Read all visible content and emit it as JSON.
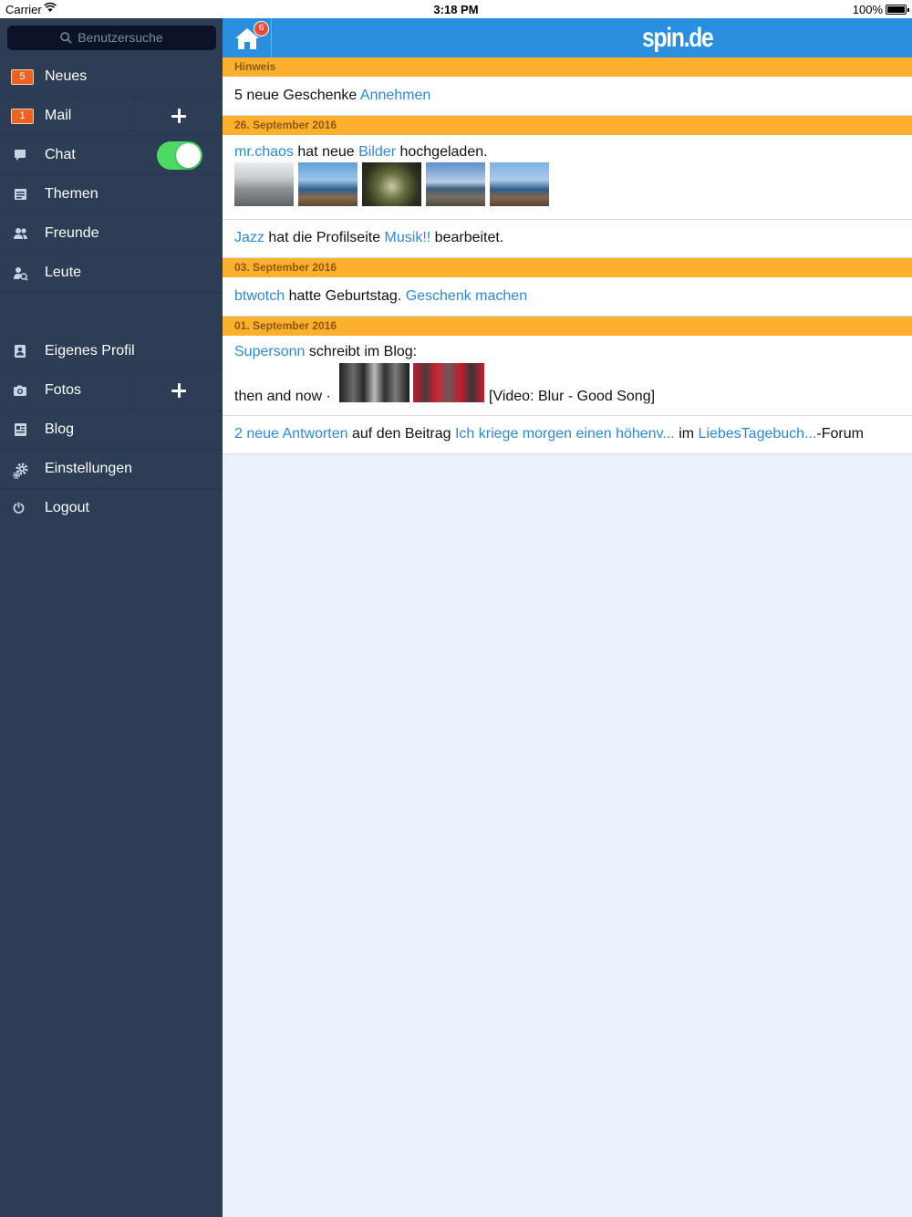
{
  "status_bar": {
    "carrier": "Carrier",
    "time": "3:18 PM",
    "battery": "100%"
  },
  "sidebar": {
    "search_placeholder": "Benutzersuche",
    "items": [
      {
        "label": "Neues",
        "badge": "5"
      },
      {
        "label": "Mail",
        "badge": "1"
      },
      {
        "label": "Chat",
        "toggle_on": true
      },
      {
        "label": "Themen"
      },
      {
        "label": "Freunde"
      },
      {
        "label": "Leute"
      },
      {
        "label": "Eigenes Profil"
      },
      {
        "label": "Fotos"
      },
      {
        "label": "Blog"
      },
      {
        "label": "Einstellungen"
      },
      {
        "label": "Logout"
      }
    ]
  },
  "topbar": {
    "home_badge": "6",
    "logo": "spin.de"
  },
  "feed": {
    "hint_header": "Hinweis",
    "hint": {
      "text": "5 neue Geschenke",
      "link": "Annehmen"
    },
    "sections": [
      {
        "date": "26. September 2016"
      },
      {
        "date": "03. September 2016"
      },
      {
        "date": "01. September 2016"
      }
    ],
    "entry1": {
      "user": "mr.chaos",
      "t1": "hat neue",
      "link": "Bilder",
      "t2": "hochgeladen."
    },
    "entry2": {
      "user": "Jazz",
      "t1": "hat die Profilseite",
      "link": "Musik!!",
      "t2": "bearbeitet."
    },
    "entry3": {
      "user": "btwotch",
      "t1": "hatte Geburtstag.",
      "link": "Geschenk machen"
    },
    "entry4": {
      "user": "Supersonn",
      "t1": "schreibt im Blog:",
      "t2": "then and now ·",
      "t3": "[Video: Blur - Good Song]"
    },
    "entry5": {
      "link1": "2 neue Antworten",
      "t1": "auf den Beitrag",
      "link2": "Ich kriege morgen einen höhenv...",
      "t2": "im",
      "link3": "LiebesTagebuch...",
      "t3": "-Forum"
    }
  },
  "colors": {
    "sidebar": "#2c3d55",
    "topbar": "#2a8fdf",
    "section_header": "#fdb02d",
    "link": "#2b8ad9",
    "toggle": "#4cd964",
    "badge": "#f0601e"
  }
}
